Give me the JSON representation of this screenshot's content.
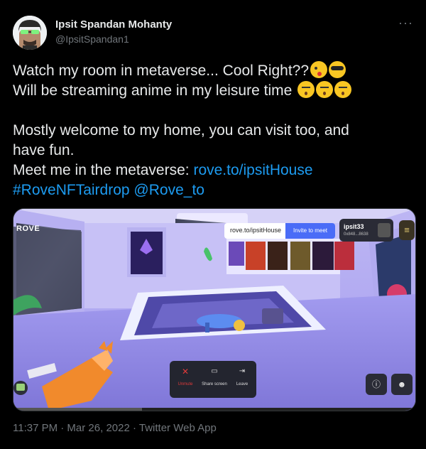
{
  "tweet": {
    "author_name": "Ipsit Spandan Mohanty",
    "author_handle": "@IpsitSpandan1",
    "more_icon": "more-icon",
    "lines": {
      "l1": "Watch my room in metaverse... Cool Right??",
      "l2": "Will be streaming anime in my leisure time",
      "l3": "Mostly welcome to my home, you can visit too, and",
      "l4": "have fun.",
      "l5_text": "Meet me in the metaverse: ",
      "l5_link": "rove.to/ipsitHouse",
      "l6_hashtag": "#RoveNFTairdrop",
      "l6_mention": "@Rove_to"
    },
    "emojis": [
      "winking-face-with-tongue",
      "smiling-face-with-sunglasses",
      "kissing-face",
      "kissing-face",
      "kissing-face"
    ],
    "timestamp": "11:37 PM · Mar 26, 2022 · Twitter Web App"
  },
  "media": {
    "logo": "ROVE",
    "url_pill": "rove.to/ipsitHouse",
    "invite_button": "Invite to meet",
    "user_name": "ipsit33",
    "user_addr": "0x848...8638",
    "controls": {
      "unmute": "Unmute",
      "share": "Share screen",
      "leave": "Leave"
    },
    "colors": {
      "accent": "#4a6cf7",
      "unmute_icon": "#e03a3a",
      "floor": "#9b93e8",
      "wall": "#c9c3f5"
    }
  }
}
